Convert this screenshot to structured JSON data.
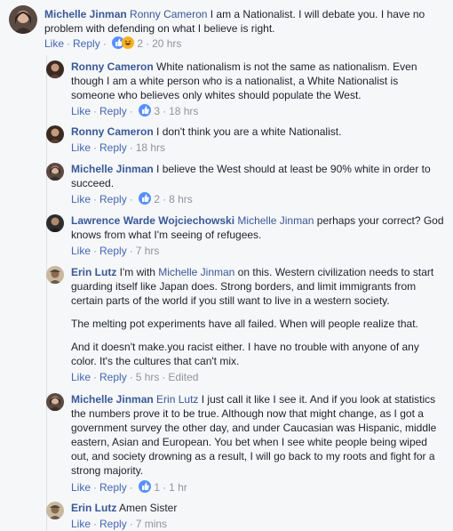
{
  "comments": [
    {
      "author": "Michelle Jinman",
      "mention": "Ronny Cameron",
      "text": " I am a Nationalist. I will debate you. I have no problem with defending on what I believe is right.",
      "like": "Like",
      "reply": "Reply",
      "reaction_count": "2",
      "time": "20 hrs",
      "reactions": [
        "like-icon",
        "haha-icon"
      ]
    },
    {
      "author": "Ronny Cameron",
      "text": " White nationalism is not the same as nationalism. Even though I am a white person who is a nationalist, a White Nationalist is someone who believes only whites should populate the West.",
      "like": "Like",
      "reply": "Reply",
      "reaction_count": "3",
      "time": "18 hrs"
    },
    {
      "author": "Ronny Cameron",
      "text": " I don't think you are a white Nationalist.",
      "like": "Like",
      "reply": "Reply",
      "time": "18 hrs"
    },
    {
      "author": "Michelle Jinman",
      "text": " I believe the West should at least be 90% white in order to succeed.",
      "like": "Like",
      "reply": "Reply",
      "reaction_count": "2",
      "time": "8 hrs"
    },
    {
      "author": "Lawrence Warde Wojciechowski",
      "mention": "Michelle Jinman",
      "text": " perhaps your correct? God knows from what I'm seeing of refugees.",
      "like": "Like",
      "reply": "Reply",
      "time": "7 hrs"
    },
    {
      "author": "Erin Lutz",
      "text_before": " I'm with ",
      "mention": "Michelle Jinman",
      "text_after": " on this. Western civilization needs to start guarding itself like Japan does. Strong borders, and limit immigrants from certain parts of the world if you still want to live in a western society.",
      "para2": "The melting pot experiments have all failed. When will people realize that.",
      "para3": "And it doesn't make.you racist either. I have no trouble with anyone of any color. It's the cultures that can't mix.",
      "like": "Like",
      "reply": "Reply",
      "time": "5 hrs",
      "edited": "Edited"
    },
    {
      "author": "Michelle Jinman",
      "mention": "Erin Lutz",
      "text": " I just call it like I see it. And if you look at statistics the numbers prove it to be true. Although now that might change, as I got a government survey the other day, and under Caucasian was Hispanic, middle eastern, Asian and European. You bet when I see white people being wiped out, and society drowning as a result, I will go back to my roots and fight for a strong majority.",
      "like": "Like",
      "reply": "Reply",
      "reaction_count": "1",
      "time": "1 hr"
    },
    {
      "author": "Erin Lutz",
      "text": " Amen Sister",
      "like": "Like",
      "reply": "Reply",
      "time": "7 mins"
    }
  ],
  "colors": {
    "name": "#385898",
    "link": "#4267b2",
    "meta": "#90949c",
    "like_blue": "#5890ff",
    "haha_yellow": "#f7b125"
  }
}
